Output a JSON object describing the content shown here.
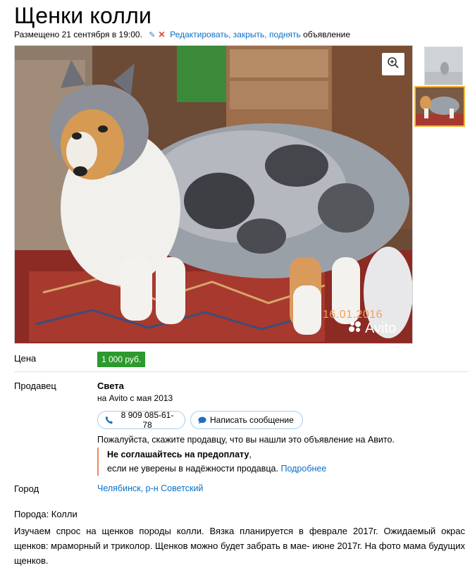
{
  "title": "Щенки колли",
  "meta": {
    "posted": "Размещено 21 сентября в 19:00.",
    "edit": "Редактировать",
    "close": "закрыть",
    "raise": "поднять",
    "suffix": "объявление"
  },
  "photo": {
    "date_stamp": "16.01.2016",
    "watermark": "Avito"
  },
  "price": {
    "label": "Цена",
    "value": "1 000 руб."
  },
  "seller": {
    "label": "Продавец",
    "name": "Света",
    "since": "на Avito с мая 2013",
    "phone": "8 909 085-61-78",
    "message_button": "Написать сообщение",
    "notice": "Пожалуйста, скажите продавцу, что вы нашли это объявление на Авито.",
    "warning_bold": "Не соглашайтесь на предоплату",
    "warning_text": "если не уверены в надёжности продавца.",
    "more_link": "Подробнее"
  },
  "city": {
    "label": "Город",
    "value": "Челябинск, р-н Советский"
  },
  "breed": "Порода: Колли",
  "description": "Изучаем спрос на щенков породы колли. Вязка планируется в феврале 2017г. Ожидаемый окрас щенков: мраморный и триколор. Щенков можно будет забрать в мае- июне 2017г. На фото мама будущих щенков.",
  "colors": {
    "price_bg": "#2d9a2d",
    "link": "#0a6fc7",
    "warning_border": "#f0885e",
    "thumb_active": "#f3b63c"
  }
}
